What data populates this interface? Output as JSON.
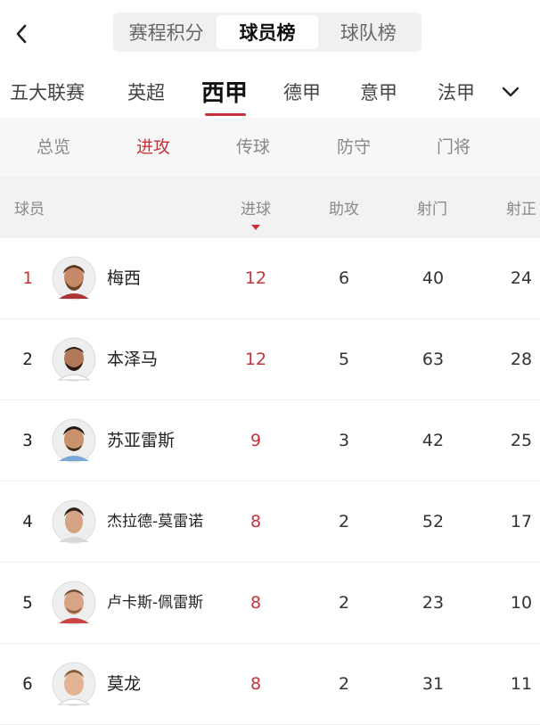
{
  "header": {
    "back_icon": "chevron-left-icon",
    "segments": [
      {
        "label": "赛程积分",
        "active": false
      },
      {
        "label": "球员榜",
        "active": true
      },
      {
        "label": "球队榜",
        "active": false
      }
    ]
  },
  "leagues": {
    "items": [
      {
        "label": "五大联赛",
        "active": false
      },
      {
        "label": "英超",
        "active": false
      },
      {
        "label": "西甲",
        "active": true
      },
      {
        "label": "德甲",
        "active": false
      },
      {
        "label": "意甲",
        "active": false
      },
      {
        "label": "法甲",
        "active": false
      }
    ],
    "more_icon": "chevron-down-icon"
  },
  "subtabs": [
    {
      "label": "总览",
      "active": false
    },
    {
      "label": "进攻",
      "active": true
    },
    {
      "label": "传球",
      "active": false
    },
    {
      "label": "防守",
      "active": false
    },
    {
      "label": "门将",
      "active": false
    }
  ],
  "table": {
    "columns": [
      "球员",
      "进球",
      "助攻",
      "射门",
      "射正"
    ],
    "sorted_by": "进球",
    "rows": [
      {
        "rank": "1",
        "name": "梅西",
        "goals": "12",
        "assists": "6",
        "shots": "40",
        "on_target": "24"
      },
      {
        "rank": "2",
        "name": "本泽马",
        "goals": "12",
        "assists": "5",
        "shots": "63",
        "on_target": "28"
      },
      {
        "rank": "3",
        "name": "苏亚雷斯",
        "goals": "9",
        "assists": "3",
        "shots": "42",
        "on_target": "25"
      },
      {
        "rank": "4",
        "name": "杰拉德-莫雷诺",
        "goals": "8",
        "assists": "2",
        "shots": "52",
        "on_target": "17"
      },
      {
        "rank": "5",
        "name": "卢卡斯-佩雷斯",
        "goals": "8",
        "assists": "2",
        "shots": "23",
        "on_target": "10"
      },
      {
        "rank": "6",
        "name": "莫龙",
        "goals": "8",
        "assists": "2",
        "shots": "31",
        "on_target": "11"
      }
    ]
  },
  "colors": {
    "accent": "#c8323c",
    "muted": "#888888",
    "header_bg": "#f2f2f2"
  }
}
